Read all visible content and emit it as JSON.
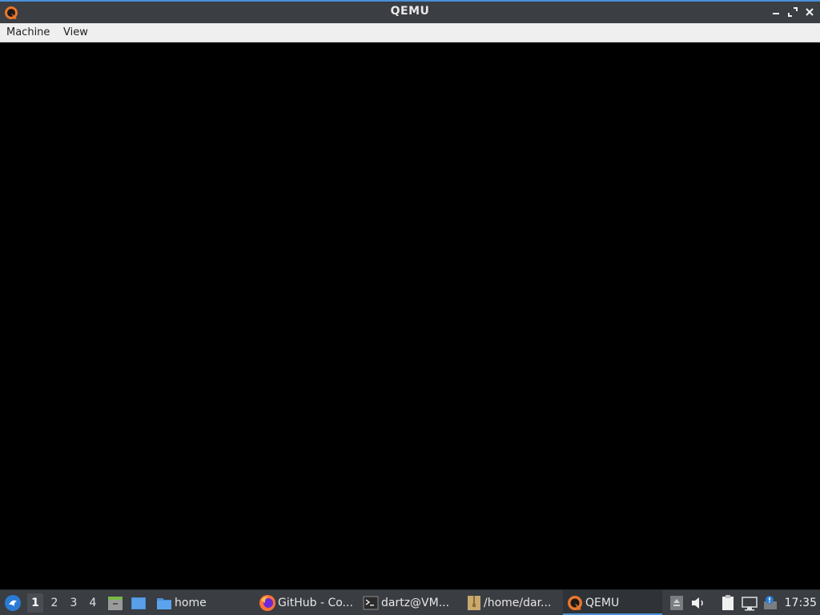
{
  "window": {
    "title": "QEMU",
    "app_icon": "qemu-icon",
    "controls": [
      "minimize-icon",
      "restore-icon",
      "close-icon"
    ]
  },
  "menubar": {
    "items": [
      "Machine",
      "View"
    ]
  },
  "taskbar": {
    "start_icon": "start-menu-icon",
    "workspaces": [
      "1",
      "2",
      "3",
      "4"
    ],
    "active_workspace": "1",
    "launchers": [
      "file-manager-icon",
      "desktop-icon"
    ],
    "tasks": [
      {
        "label": "home",
        "icon": "folder-icon"
      },
      {
        "label": "GitHub - Co...",
        "icon": "firefox-icon"
      },
      {
        "label": "dartz@VM...",
        "icon": "terminal-icon"
      },
      {
        "label": "/home/dar...",
        "icon": "archive-icon"
      },
      {
        "label": "QEMU",
        "icon": "qemu-icon",
        "active": true
      }
    ],
    "tray": [
      "eject-icon",
      "volume-icon",
      "clipboard-icon",
      "network-icon",
      "update-icon"
    ],
    "clock": "17:35"
  },
  "colors": {
    "titlebar": "#3b3e43",
    "accent": "#4a90d9",
    "menubar": "#efefef",
    "taskbar": "#3a3d42",
    "display": "#000000"
  }
}
